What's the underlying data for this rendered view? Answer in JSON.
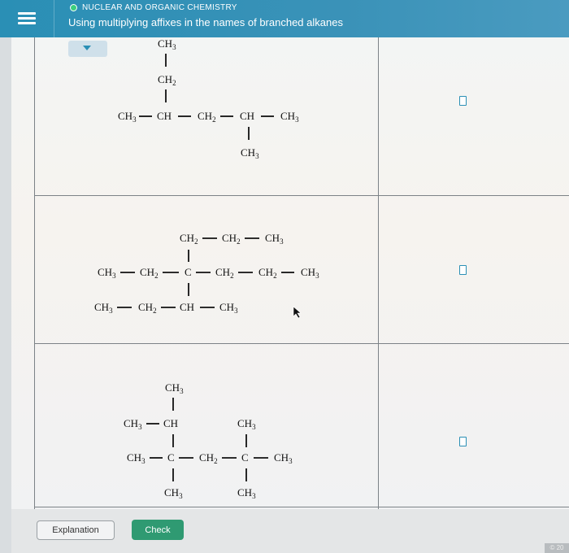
{
  "header": {
    "topic": "NUCLEAR AND ORGANIC CHEMISTRY",
    "title": "Using multiplying affixes in the names of branched alkanes"
  },
  "structures": [
    {
      "groups": [
        "CH3",
        "CH2",
        "CH3",
        "CH",
        "CH2",
        "CH",
        "CH3",
        "CH3"
      ],
      "answer": ""
    },
    {
      "groups": [
        "CH2",
        "CH2",
        "CH3",
        "CH3",
        "CH2",
        "C",
        "CH2",
        "CH2",
        "CH3",
        "CH3",
        "CH2",
        "CH",
        "CH3"
      ],
      "answer": ""
    },
    {
      "groups": [
        "CH3",
        "CH3",
        "CH",
        "CH3",
        "CH3",
        "C",
        "CH2",
        "C",
        "CH3",
        "CH3",
        "CH3"
      ],
      "answer": ""
    }
  ],
  "footer": {
    "explanation_label": "Explanation",
    "check_label": "Check",
    "corner_text": "© 20"
  },
  "colors": {
    "accent": "#2a8fb5",
    "check": "#2f9a72",
    "topic_dot": "#3ccf7d"
  },
  "icons": [
    "hamburger-menu-icon",
    "dropdown-caret-icon",
    "mouse-pointer-icon"
  ]
}
